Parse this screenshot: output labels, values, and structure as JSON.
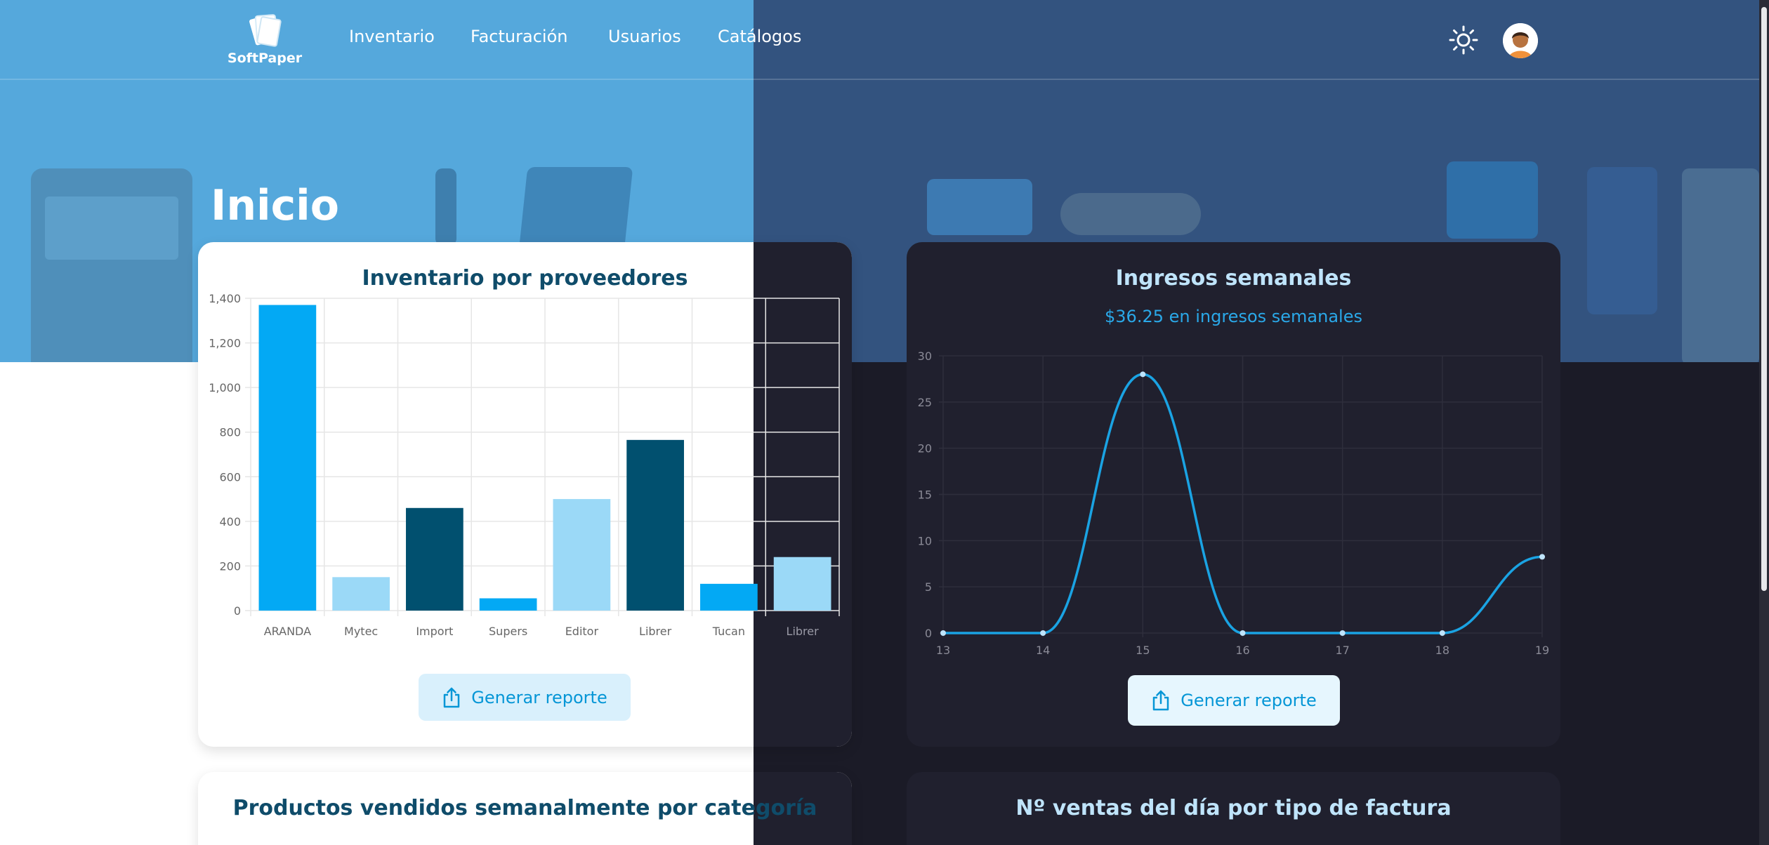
{
  "brand": {
    "name": "SoftPaper"
  },
  "nav": {
    "items": [
      {
        "label": "Inventario"
      },
      {
        "label": "Facturación"
      },
      {
        "label": "Usuarios"
      },
      {
        "label": "Catálogos"
      }
    ],
    "theme_icon": "sun-icon",
    "avatar_icon": "user-avatar"
  },
  "page": {
    "title": "Inicio"
  },
  "cards": {
    "inventory": {
      "title": "Inventario por proveedores",
      "report_label": "Generar reporte"
    },
    "income": {
      "title": "Ingresos semanales",
      "subtitle": "$36.25 en ingresos semanales",
      "report_label": "Generar reporte"
    },
    "products": {
      "title": "Productos vendidos semanalmente por categoría"
    },
    "sales": {
      "title": "Nº ventas del día por tipo de factura"
    }
  },
  "colors": {
    "accent": "#03a9f4",
    "dark_blue": "#01506f",
    "light_blue": "#9bd9f7",
    "title_dark": "#0f4c6a",
    "title_light": "#bfe4fb"
  },
  "chart_data": [
    {
      "type": "bar",
      "title": "Inventario por proveedores",
      "categories": [
        "ARANDA",
        "Mytec",
        "Import",
        "Supers",
        "Editor",
        "Librer",
        "Tucan",
        "Librer"
      ],
      "values": [
        1370,
        150,
        460,
        55,
        500,
        765,
        120,
        240
      ],
      "bar_colors": [
        "#03a9f4",
        "#9bd9f7",
        "#01506f",
        "#03a9f4",
        "#9bd9f7",
        "#01506f",
        "#03a9f4",
        "#9bd9f7"
      ],
      "ylim": [
        0,
        1400
      ],
      "yticks": [
        "0",
        "200",
        "400",
        "600",
        "800",
        "1,000",
        "1,200",
        "1,400"
      ],
      "grid": true
    },
    {
      "type": "line",
      "title": "Ingresos semanales",
      "subtitle": "$36.25 en ingresos semanales",
      "x": [
        13,
        14,
        15,
        16,
        17,
        18,
        19
      ],
      "values": [
        0,
        0,
        28,
        0,
        0,
        0,
        8.25
      ],
      "ylim": [
        0,
        30
      ],
      "yticks": [
        "0",
        "5",
        "10",
        "15",
        "20",
        "25",
        "30"
      ],
      "grid": true
    }
  ]
}
